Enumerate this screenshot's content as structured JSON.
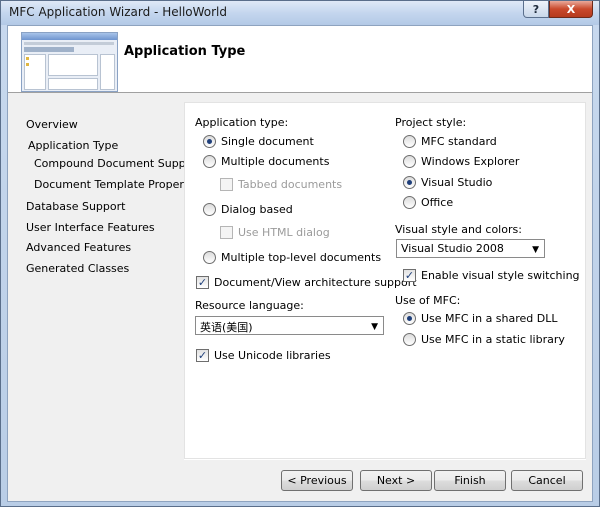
{
  "window": {
    "title": "MFC Application Wizard - HelloWorld",
    "help_glyph": "?",
    "close_glyph": "X"
  },
  "header": {
    "title": "Application Type"
  },
  "nav": {
    "items": [
      "Overview",
      "Application Type",
      "Compound Document Support",
      "Document Template Properties",
      "Database Support",
      "User Interface Features",
      "Advanced Features",
      "Generated Classes"
    ]
  },
  "app_type": {
    "label": "Application type:",
    "single": "Single document",
    "multiple": "Multiple documents",
    "tabbed": "Tabbed documents",
    "dialog": "Dialog based",
    "html_dialog": "Use HTML dialog",
    "toplevel": "Multiple top-level documents",
    "docview": "Document/View architecture support",
    "selected": "single"
  },
  "resource": {
    "label": "Resource language:",
    "value": "英语(美国)"
  },
  "unicode": {
    "label": "Use Unicode libraries"
  },
  "project_style": {
    "label": "Project style:",
    "mfc_standard": "MFC standard",
    "explorer": "Windows Explorer",
    "visual_studio": "Visual Studio",
    "office": "Office",
    "selected": "visual_studio"
  },
  "visual_style": {
    "label": "Visual style and colors:",
    "value": "Visual Studio 2008",
    "switching": "Enable visual style switching"
  },
  "mfc_use": {
    "label": "Use of MFC:",
    "shared": "Use MFC in a shared DLL",
    "static": "Use MFC in a static library",
    "selected": "shared"
  },
  "buttons": {
    "previous": "< Previous",
    "next": "Next >",
    "finish": "Finish",
    "cancel": "Cancel"
  }
}
